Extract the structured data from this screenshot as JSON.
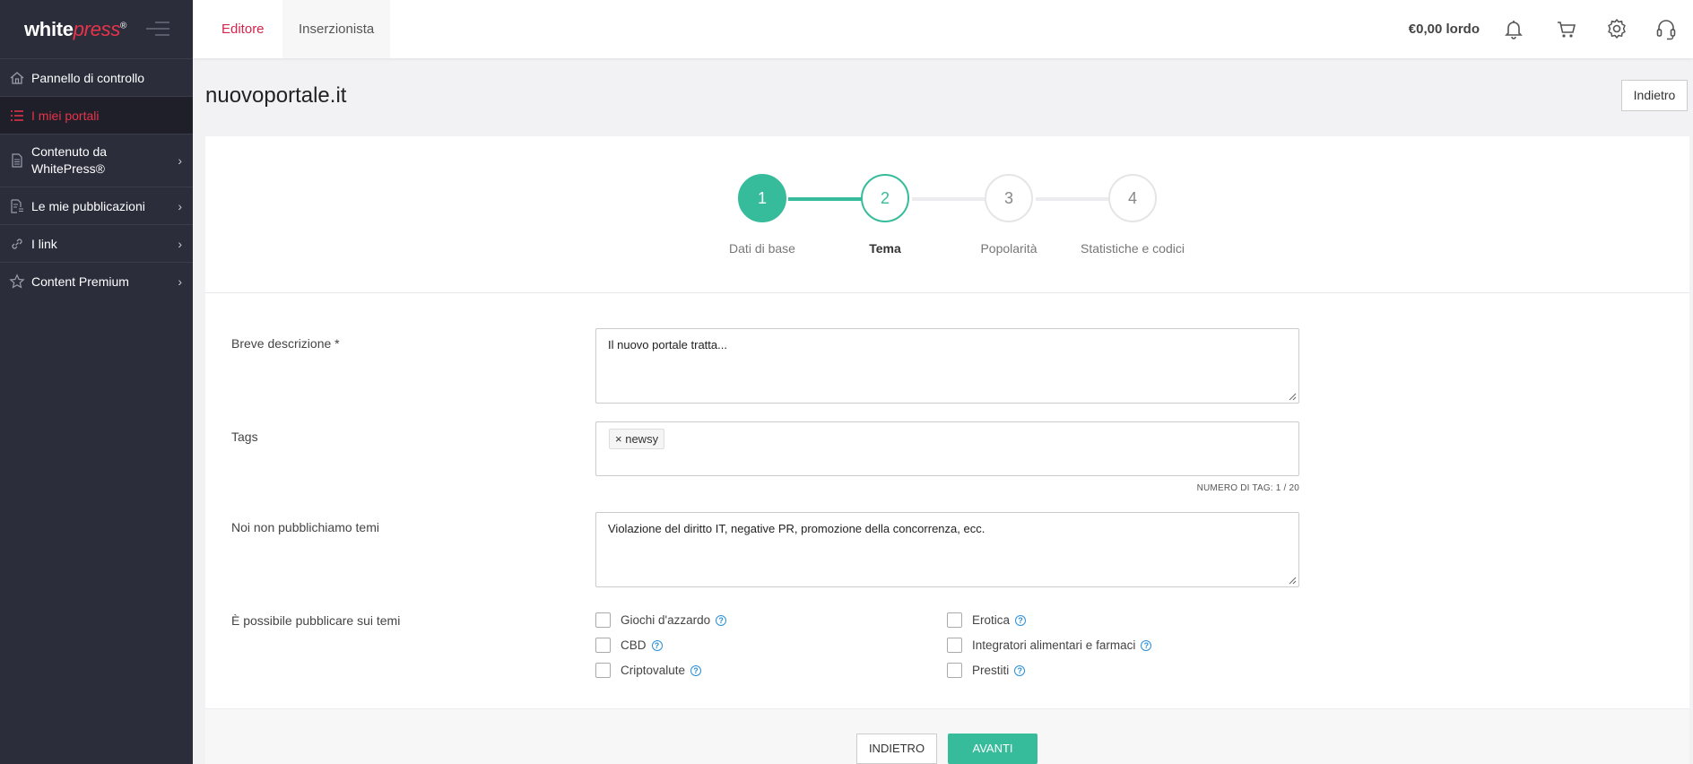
{
  "logo": {
    "white": "white",
    "press": "press",
    "mark": "®"
  },
  "sidebar": {
    "items": [
      {
        "label": "Pannello di controllo",
        "icon": "home-icon"
      },
      {
        "label": "I miei portali",
        "icon": "list-icon",
        "active": true
      },
      {
        "label": "Contenuto da WhitePress®",
        "icon": "document-icon",
        "chevron": true
      },
      {
        "label": "Le mie pubblicazioni",
        "icon": "publications-icon",
        "chevron": true
      },
      {
        "label": "I link",
        "icon": "link-icon",
        "chevron": true
      },
      {
        "label": "Content Premium",
        "icon": "star-icon",
        "chevron": true
      }
    ]
  },
  "topbar": {
    "tabs": [
      {
        "label": "Editore",
        "active": true
      },
      {
        "label": "Inserzionista",
        "active": false
      }
    ],
    "balance": "€0,00 lordo",
    "icons": [
      "bell-icon",
      "cart-icon",
      "gear-icon",
      "headset-icon"
    ]
  },
  "page": {
    "title": "nuovoportale.it",
    "back_button": "Indietro"
  },
  "stepper": {
    "steps": [
      {
        "number": "1",
        "label": "Dati di base",
        "state": "done"
      },
      {
        "number": "2",
        "label": "Tema",
        "state": "current"
      },
      {
        "number": "3",
        "label": "Popolarità",
        "state": "todo"
      },
      {
        "number": "4",
        "label": "Statistiche e codici",
        "state": "todo"
      }
    ],
    "accent": "#36bc9b"
  },
  "form": {
    "description": {
      "label": "Breve descrizione *",
      "value": "Il nuovo portale tratta..."
    },
    "tags": {
      "label": "Tags",
      "chips": [
        "newsy"
      ],
      "counter": "NUMERO DI TAG: 1 / 20"
    },
    "excluded": {
      "label": "Noi non pubblichiamo temi",
      "value": "Violazione del diritto IT, negative PR, promozione della concorrenza, ecc."
    },
    "allowed": {
      "label": "È possibile pubblicare sui temi",
      "options": [
        {
          "label": "Giochi d'azzardo",
          "checked": false
        },
        {
          "label": "CBD",
          "checked": false
        },
        {
          "label": "Criptovalute",
          "checked": false
        },
        {
          "label": "Erotica",
          "checked": false
        },
        {
          "label": "Integratori alimentari e farmaci",
          "checked": false
        },
        {
          "label": "Prestiti",
          "checked": false
        }
      ]
    }
  },
  "footer": {
    "back_label": "INDIETRO",
    "next_label": "AVANTI"
  },
  "colors": {
    "brand_red": "#e8334a",
    "sidebar_bg": "#2b2d3b",
    "accent_green": "#36bc9b"
  }
}
